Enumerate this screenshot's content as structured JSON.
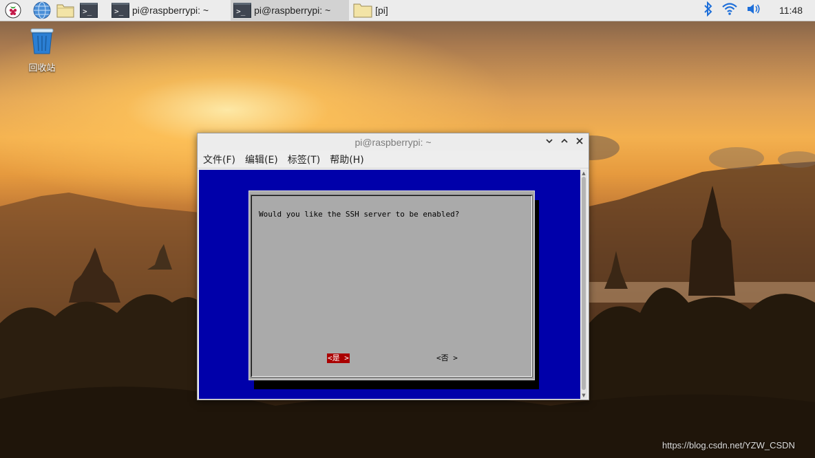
{
  "taskbar": {
    "tasks": [
      {
        "label": "pi@raspberrypi: ~",
        "icon": "terminal-icon"
      },
      {
        "label": "pi@raspberrypi: ~",
        "icon": "terminal-icon",
        "active": true
      },
      {
        "label": "[pi]",
        "icon": "folder-icon"
      }
    ],
    "clock": "11:48"
  },
  "desktop": {
    "trash_label": "回收站"
  },
  "window": {
    "title": "pi@raspberrypi: ~",
    "menu": [
      "文件(F)",
      "编辑(E)",
      "标签(T)",
      "帮助(H)"
    ]
  },
  "dialog": {
    "question": "Would you like the SSH server to be enabled?",
    "yes_label": "<是 >",
    "no_label": "<否 >",
    "colors": {
      "terminal_bg": "#0000aa",
      "dialog_bg": "#aaaaaa",
      "selected_button_bg": "#aa0000"
    }
  },
  "watermark": "https://blog.csdn.net/YZW_CSDN"
}
